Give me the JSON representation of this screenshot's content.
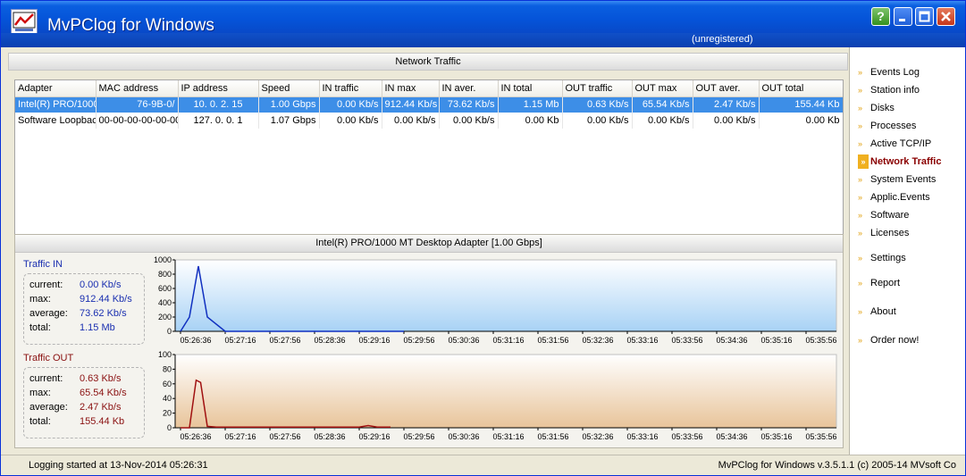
{
  "window": {
    "title": "MvPClog for Windows",
    "registration": "(unregistered)"
  },
  "network_traffic": {
    "title": "Network Traffic",
    "columns": [
      "Adapter",
      "MAC address",
      "IP address",
      "Speed",
      "IN traffic",
      "IN max",
      "IN aver.",
      "IN total",
      "OUT traffic",
      "OUT max",
      "OUT aver.",
      "OUT total"
    ],
    "rows": [
      [
        "Intel(R) PRO/1000",
        "76-9B-0/",
        "10. 0. 2. 15",
        "1.00 Gbps",
        "0.00 Kb/s",
        "912.44 Kb/s",
        "73.62 Kb/s",
        "1.15 Mb",
        "0.63 Kb/s",
        "65.54 Kb/s",
        "2.47 Kb/s",
        "155.44 Kb"
      ],
      [
        "Software Loopbac",
        "00-00-00-00-00-00",
        "127. 0. 0. 1",
        "1.07 Gbps",
        "0.00 Kb/s",
        "0.00 Kb/s",
        "0.00 Kb/s",
        "0.00 Kb",
        "0.00 Kb/s",
        "0.00 Kb/s",
        "0.00 Kb/s",
        "0.00 Kb"
      ]
    ]
  },
  "adapter_panel": {
    "title": "Intel(R) PRO/1000 MT Desktop Adapter [1.00 Gbps]",
    "traffic_in": {
      "title": "Traffic IN",
      "current_label": "current:",
      "current": "0.00 Kb/s",
      "max_label": "max:",
      "max": "912.44 Kb/s",
      "average_label": "average:",
      "average": "73.62 Kb/s",
      "total_label": "total:",
      "total": "1.15 Mb"
    },
    "traffic_out": {
      "title": "Traffic OUT",
      "current_label": "current:",
      "current": "0.63 Kb/s",
      "max_label": "max:",
      "max": "65.54 Kb/s",
      "average_label": "average:",
      "average": "2.47 Kb/s",
      "total_label": "total:",
      "total": "155.44 Kb"
    }
  },
  "chart_data": [
    {
      "type": "line",
      "ylim": [
        0,
        1000
      ],
      "yticks": [
        0,
        200,
        400,
        600,
        800,
        1000
      ],
      "categories": [
        "05:26:36",
        "05:27:16",
        "05:27:56",
        "05:28:36",
        "05:29:16",
        "05:29:56",
        "05:30:36",
        "05:31:16",
        "05:31:56",
        "05:32:36",
        "05:33:16",
        "05:33:56",
        "05:34:36",
        "05:35:16",
        "05:35:56"
      ],
      "x": [
        0,
        0.2,
        0.4,
        0.6,
        1,
        2,
        3,
        4,
        5
      ],
      "values": [
        0,
        200,
        912,
        200,
        0,
        0,
        0,
        0,
        0
      ],
      "color": "#1030c0",
      "fill_top": "#ffffff",
      "fill_bottom": "#a8d2f5"
    },
    {
      "type": "line",
      "ylim": [
        0,
        100
      ],
      "yticks": [
        0,
        20,
        40,
        60,
        80,
        100
      ],
      "categories": [
        "05:26:36",
        "05:27:16",
        "05:27:56",
        "05:28:36",
        "05:29:16",
        "05:29:56",
        "05:30:36",
        "05:31:16",
        "05:31:56",
        "05:32:36",
        "05:33:16",
        "05:33:56",
        "05:34:36",
        "05:35:16",
        "05:35:56"
      ],
      "x": [
        0,
        0.2,
        0.35,
        0.45,
        0.6,
        0.8,
        1,
        1.5,
        2,
        2.5,
        3,
        3.5,
        4,
        4.2,
        4.4,
        4.7
      ],
      "values": [
        0,
        0,
        65,
        62,
        2,
        1,
        1,
        1,
        1,
        1,
        1,
        1,
        1,
        3,
        1,
        1
      ],
      "color": "#a01010",
      "fill_top": "#ffffff",
      "fill_bottom": "#e8c49a"
    }
  ],
  "sidebar": {
    "items": [
      "Events Log",
      "Station info",
      "Disks",
      "Processes",
      "Active TCP/IP",
      "Network Traffic",
      "System Events",
      "Applic.Events",
      "Software",
      "Licenses",
      "Settings",
      "Report",
      "About",
      "Order now!"
    ],
    "active_index": 5
  },
  "status": {
    "left": "Logging started at 13-Nov-2014 05:26:31",
    "right": "MvPClog for Windows v.3.5.1.1 (c) 2005-14 MVsoft Co"
  },
  "colors": {
    "accent": "#0553d8",
    "selected_row": "#3d8ee7",
    "active_nav": "#8a0000"
  }
}
